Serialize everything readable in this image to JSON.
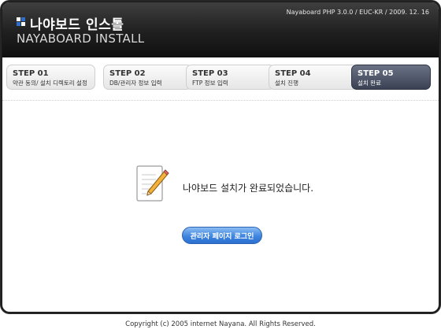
{
  "header": {
    "title_ko": "나야보드 인스톨",
    "title_en": "NAYABOARD INSTALL",
    "version": "Nayaboard PHP 3.0.0 / EUC-KR / 2009. 12. 16"
  },
  "steps": [
    {
      "num": "STEP 01",
      "label": "약관 동의/ 설치 디렉토리 설정"
    },
    {
      "num": "STEP 02",
      "label": "DB/관리자 정보 입력"
    },
    {
      "num": "STEP 03",
      "label": "FTP 정보 입력"
    },
    {
      "num": "STEP 04",
      "label": "설치 진행"
    },
    {
      "num": "STEP 05",
      "label": "설치 완료"
    }
  ],
  "active_step": 5,
  "main": {
    "message": "나야보드 설치가 완료되었습니다.",
    "login_button": "관리자 페이지 로그인"
  },
  "footer": {
    "copyright": "Copyright (c) 2005 internet Nayana. All Rights Reserved."
  },
  "icons": [
    "logo-mark-icon",
    "document-pencil-icon"
  ],
  "colors": {
    "header_bg": "#1f1f1f",
    "active_step_bg": "#4a5264",
    "button_blue": "#3f86e0"
  }
}
